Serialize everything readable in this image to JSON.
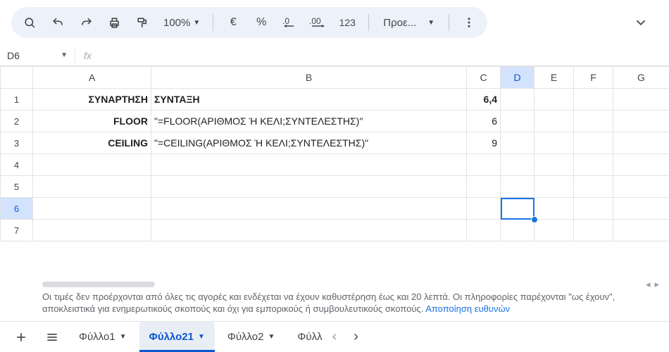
{
  "toolbar": {
    "zoom_label": "100%",
    "currency_label": "€",
    "percent_label": "%",
    "decimal_dec_label": ".0",
    "decimal_inc_label": ".00",
    "numfmt_label": "123",
    "defaults_label": "Προε..."
  },
  "namebox": {
    "value": "D6"
  },
  "fx": {
    "placeholder": ""
  },
  "columns": [
    "A",
    "B",
    "C",
    "D",
    "E",
    "F",
    "G"
  ],
  "rows": [
    "1",
    "2",
    "3",
    "4",
    "5",
    "6",
    "7"
  ],
  "cells": {
    "A1": "ΣΥΝΑΡΤΗΣΗ",
    "B1": "ΣΥΝΤΑΞΗ",
    "C1": "6,4",
    "A2": "FLOOR",
    "B2": "\"=FLOOR(ΑΡΙΘΜΟΣ Ή ΚΕΛΙ;ΣΥΝΤΕΛΕΣΤΗΣ)\"",
    "C2": "6",
    "A3": "CEILING",
    "B3": "\"=CEILING(ΑΡΙΘΜΟΣ Ή ΚΕΛΙ;ΣΥΝΤΕΛΕΣΤΗΣ)\"",
    "C3": "9"
  },
  "disclaimer": {
    "text": "Οι τιμές δεν προέρχονται από όλες τις αγορές και ενδέχεται να έχουν καθυστέρηση έως και 20 λεπτά. Οι πληροφορίες παρέχονται \"ως έχουν\", αποκλειστικά για ενημερωτικούς σκοπούς και όχι για εμπορικούς ή συμβουλευτικούς σκοπούς. ",
    "link": "Αποποίηση ευθυνών"
  },
  "sheets": {
    "items": [
      {
        "label": "Φύλλο1",
        "active": false
      },
      {
        "label": "Φύλλο21",
        "active": true
      },
      {
        "label": "Φύλλο2",
        "active": false
      },
      {
        "label": "Φύλλ",
        "active": false
      }
    ]
  },
  "selection": {
    "col": "D",
    "row": "6"
  }
}
